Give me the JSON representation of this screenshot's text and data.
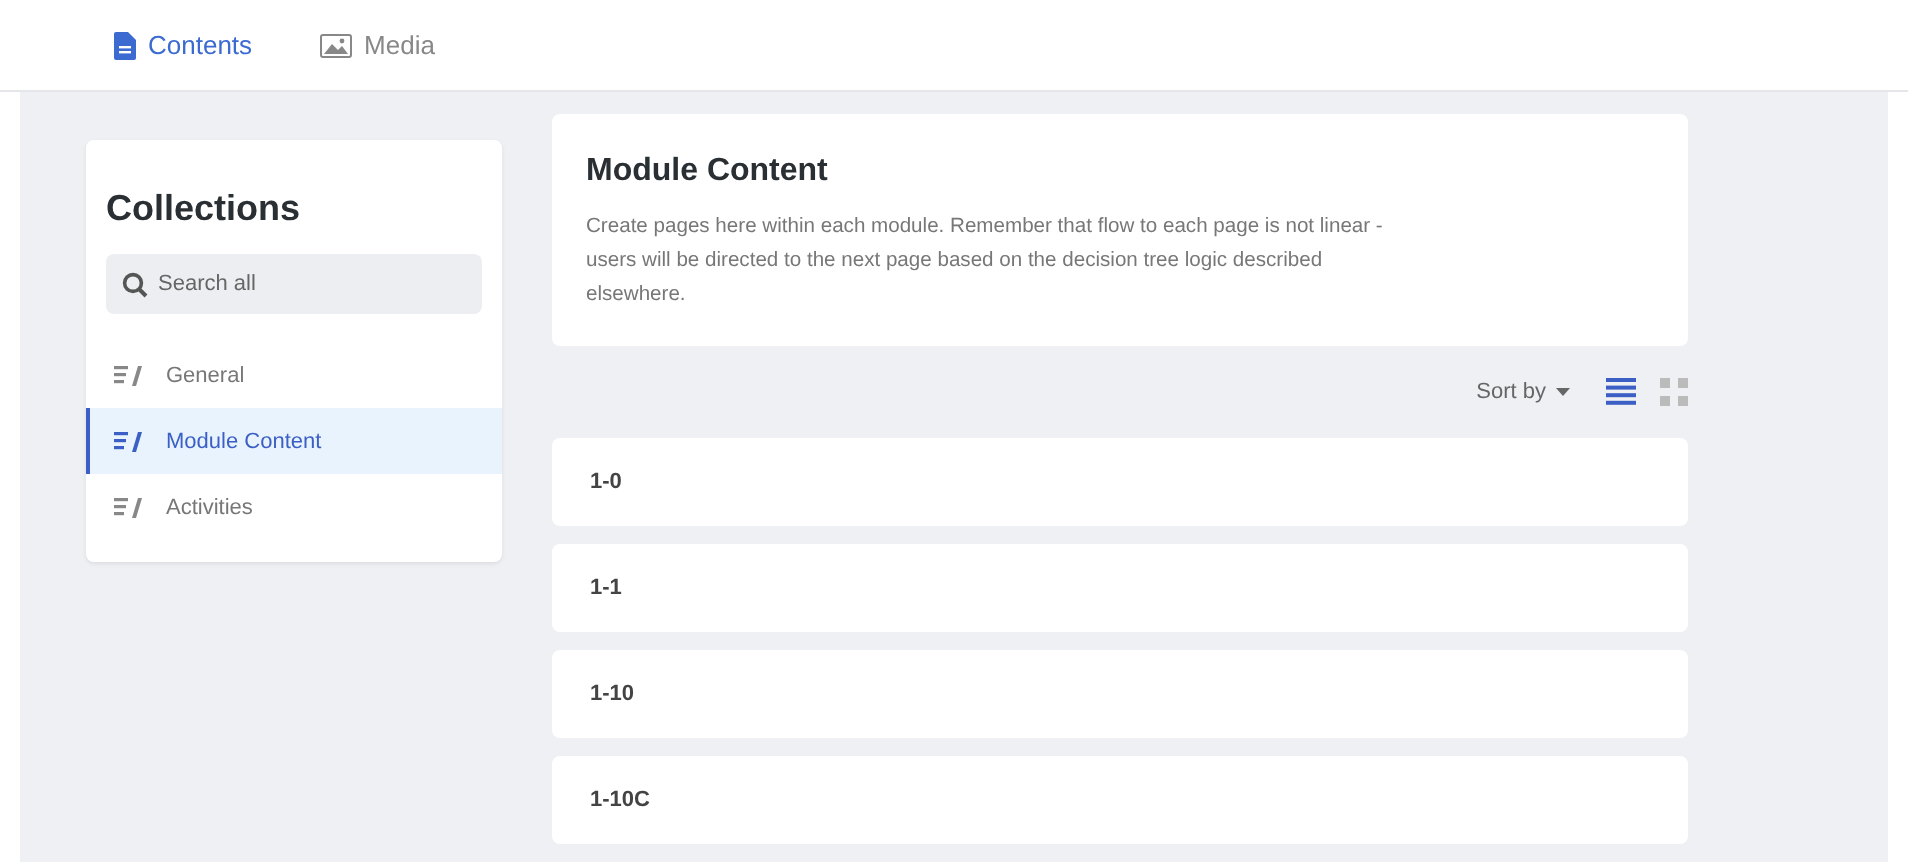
{
  "tabs": [
    {
      "label": "Contents",
      "kind": "document",
      "selected": true
    },
    {
      "label": "Media",
      "kind": "image",
      "selected": false
    }
  ],
  "sidebar": {
    "title": "Collections",
    "search": {
      "placeholder": "Search all"
    },
    "items": [
      {
        "label": "General",
        "selected": false
      },
      {
        "label": "Module Content",
        "selected": true
      },
      {
        "label": "Activities",
        "selected": false
      }
    ]
  },
  "header": {
    "title": "Module Content",
    "description": "Create pages here within each module. Remember that flow to each page is not linear - users will be directed to the next page based on the decision tree logic described elsewhere."
  },
  "toolbar": {
    "sort_label": "Sort by",
    "views": [
      {
        "kind": "list",
        "selected": true
      },
      {
        "kind": "grid",
        "selected": false
      }
    ]
  },
  "entries": [
    "1-0",
    "1-1",
    "1-10",
    "1-10C"
  ]
}
